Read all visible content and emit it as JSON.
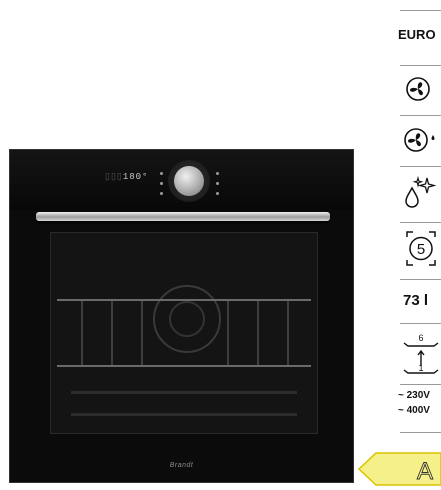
{
  "product": {
    "brand": "Brandt",
    "display_temp": "180°"
  },
  "specs": {
    "badge": "EURO",
    "capacity": "73 l",
    "shelf_top": "6",
    "shelf_bottom": "1",
    "voltage_1": "~ 230V",
    "voltage_2": "~ 400V",
    "cleaning_cycles": "5"
  },
  "energy_class": "A",
  "icons": [
    "fan-icon",
    "fan-steam-icon",
    "water-sparkle-icon",
    "cleaning-timer-icon",
    "shelf-levels-icon"
  ],
  "colors": {
    "energy_label": "#f5f08a",
    "energy_border": "#d9c400"
  }
}
